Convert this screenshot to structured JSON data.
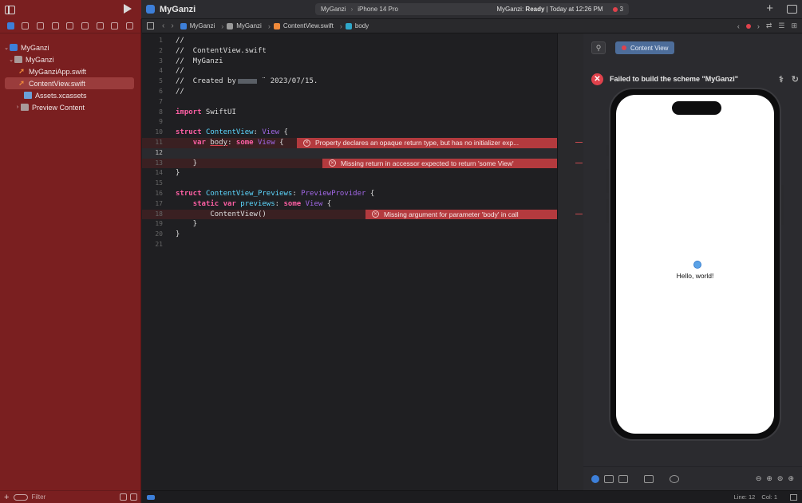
{
  "toolbar": {
    "project_title": "MyGanzi",
    "scheme": "MyGanzi",
    "device": "iPhone 14 Pro",
    "status_prefix": "MyGanzi:",
    "status_state": "Ready",
    "status_time": "| Today at 12:26 PM",
    "error_count": "3"
  },
  "navigator": {
    "items": [
      {
        "label": "MyGanzi",
        "level": 0,
        "icon": "project-icon"
      },
      {
        "label": "MyGanzi",
        "level": 1,
        "icon": "folder-icon"
      },
      {
        "label": "MyGanziApp.swift",
        "level": 2,
        "icon": "swift-file-icon"
      },
      {
        "label": "ContentView.swift",
        "level": 2,
        "icon": "swift-file-icon",
        "selected": true
      },
      {
        "label": "Assets.xcassets",
        "level": 2,
        "icon": "assets-icon"
      },
      {
        "label": "Preview Content",
        "level": 2,
        "icon": "folder-icon"
      }
    ],
    "filter_placeholder": "Filter"
  },
  "jumpbar": {
    "crumbs": [
      "MyGanzi",
      "MyGanzi",
      "ContentView.swift",
      "body"
    ]
  },
  "editor": {
    "lines": [
      "//",
      "//  ContentView.swift",
      "//  MyGanzi",
      "//",
      "//  Created by",
      "//",
      "",
      "import SwiftUI",
      "",
      "struct ContentView: View {",
      "    var body: some View {",
      "",
      "    }",
      "}",
      "",
      "struct ContentView_Previews: PreviewProvider {",
      "    static var previews: some View {",
      "        ContentView()",
      "    }",
      "}",
      ""
    ],
    "created_date": "¨ 2023/07/15.",
    "errors": {
      "line11": "Property declares an opaque return type, but has no initializer exp...",
      "line13": "Missing return in accessor expected to return 'some View'",
      "line18": "Missing argument for parameter 'body' in call"
    }
  },
  "canvas": {
    "tab_label": "Content View",
    "fail_message": "Failed to build the scheme \"MyGanzi\"",
    "hello_text": "Hello, world!"
  },
  "statusbar": {
    "line": "Line: 12",
    "col": "Col: 1"
  },
  "colors": {
    "navigator_bg": "#7a1f20",
    "error_red": "#e0424c",
    "accent": "#3d7fd9"
  }
}
